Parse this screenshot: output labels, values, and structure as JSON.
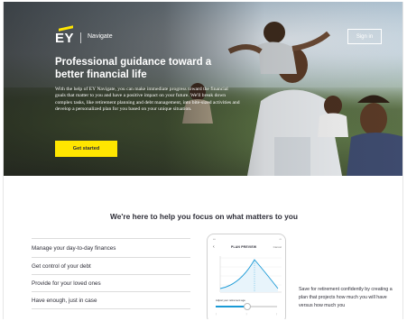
{
  "header": {
    "brand": "EY",
    "product": "Navigate",
    "signin_label": "Sign in"
  },
  "hero": {
    "title": "Professional guidance toward a better financial life",
    "body": "With the help of EY Navigate, you can make immediate progress toward the financial goals that matter to you and have a positive impact on your future. We'll break down complex tasks, like retirement planning and debt management, into bite-sized activities and develop a personalized plan for you based on your unique situation.",
    "cta_label": "Get started"
  },
  "section": {
    "title": "We're here to help you focus on what matters to you",
    "items": [
      {
        "label": "Manage your day-to-day finances"
      },
      {
        "label": "Get control of your debt"
      },
      {
        "label": "Provide for your loved ones"
      },
      {
        "label": "Have enough, just in case"
      }
    ]
  },
  "phone": {
    "title": "PLAN PREVIEW",
    "cancel_label": "Cancel",
    "back_icon": "chevron-left-icon",
    "slider_label": "Adjust your retirement age",
    "slider_value_percent": 52
  },
  "description": "Save for retirement confidently by creating a plan that projects how much you will have versus how much you",
  "colors": {
    "accent": "#ffe600",
    "dark": "#2e2e38",
    "chart_line": "#1a9ad6"
  }
}
